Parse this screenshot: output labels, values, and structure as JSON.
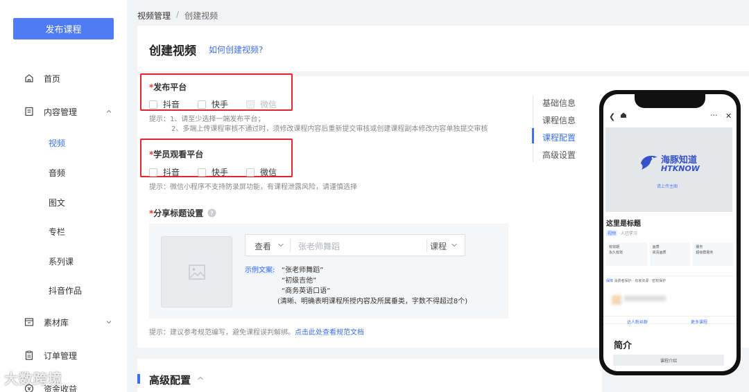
{
  "sidebar": {
    "publish_label": "发布课程",
    "items": [
      {
        "label": "首页"
      },
      {
        "label": "内容管理"
      },
      {
        "label": "素材库"
      },
      {
        "label": "订单管理"
      },
      {
        "label": "资金收益"
      }
    ],
    "content_sub": [
      {
        "label": "视频",
        "active": true
      },
      {
        "label": "音频"
      },
      {
        "label": "图文"
      },
      {
        "label": "专栏"
      },
      {
        "label": "系列课"
      },
      {
        "label": "抖音作品"
      }
    ]
  },
  "breadcrumb": {
    "parent": "视频管理",
    "sep": "/",
    "current": "创建视频"
  },
  "header": {
    "title": "创建视频",
    "help_link": "如何创建视频?"
  },
  "publish_platform": {
    "required_mark": "*",
    "title": "发布平台",
    "options": [
      {
        "label": "抖音",
        "checked": false
      },
      {
        "label": "快手",
        "checked": false
      },
      {
        "label": "微信",
        "checked": false,
        "disabled": true
      }
    ],
    "hint_line1": "提示：1、请至少选择一端发布平台；",
    "hint_line2": "2、多端上传课程审核不通过时，须修改课程内容后重新提交审核或创建课程副本修改内容单独提交审核"
  },
  "watch_platform": {
    "required_mark": "*",
    "title": "学员观看平台",
    "options": [
      {
        "label": "抖音",
        "checked": false
      },
      {
        "label": "快手",
        "checked": false
      },
      {
        "label": "微信",
        "checked": false
      }
    ],
    "hint": "提示：微信小程序不支持防录屏功能，有课程泄露风险，请谨慎选择"
  },
  "share_title": {
    "required_mark": "*",
    "title": "分享标题设置",
    "prefix_value": "查看",
    "placeholder": "张老师舞蹈",
    "suffix_value": "课程",
    "example_label": "示例文案:",
    "examples": [
      "“张老师舞蹈”",
      "“初级吉他”",
      "“商务英语口语”"
    ],
    "example_note": "(清晰、明确表明课程所授内容及所属垂类，字数不得超过8个)"
  },
  "bottom_hint": {
    "text": "提示：建议参考规范编写，避免课程误判解绑。",
    "link": "点击此处查看规范文档"
  },
  "anchor_nav": [
    {
      "label": "基础信息"
    },
    {
      "label": "课程信息"
    },
    {
      "label": "课程配置",
      "active": true
    },
    {
      "label": "高级设置"
    }
  ],
  "advanced": {
    "title": "高级配置"
  },
  "phone_preview": {
    "logo_cn": "海豚知道",
    "logo_en": "HTKNOW",
    "upload_hint": "请上传主图",
    "course_title": "这里是标题",
    "tag": "视频",
    "learners": "·人已学习",
    "features": [
      {
        "title": "有效期",
        "desc": "永久有效"
      },
      {
        "title": "画质",
        "desc": "高清画质"
      },
      {
        "title": "服务",
        "desc": "超级群服务"
      }
    ],
    "protect_label": "保障",
    "protect_text": "消费者保护 · 有家资源 · 密权保护",
    "action1": "达人粉丝群",
    "action2": "更多课程",
    "intro_title": "简介",
    "intro_button": "课程介绍"
  },
  "watermark": "大数跨境",
  "colors": {
    "accent": "#3a6ff0",
    "publish_button": "#4f7cf5",
    "highlight_box": "#e1252b",
    "required": "#e5382a"
  }
}
